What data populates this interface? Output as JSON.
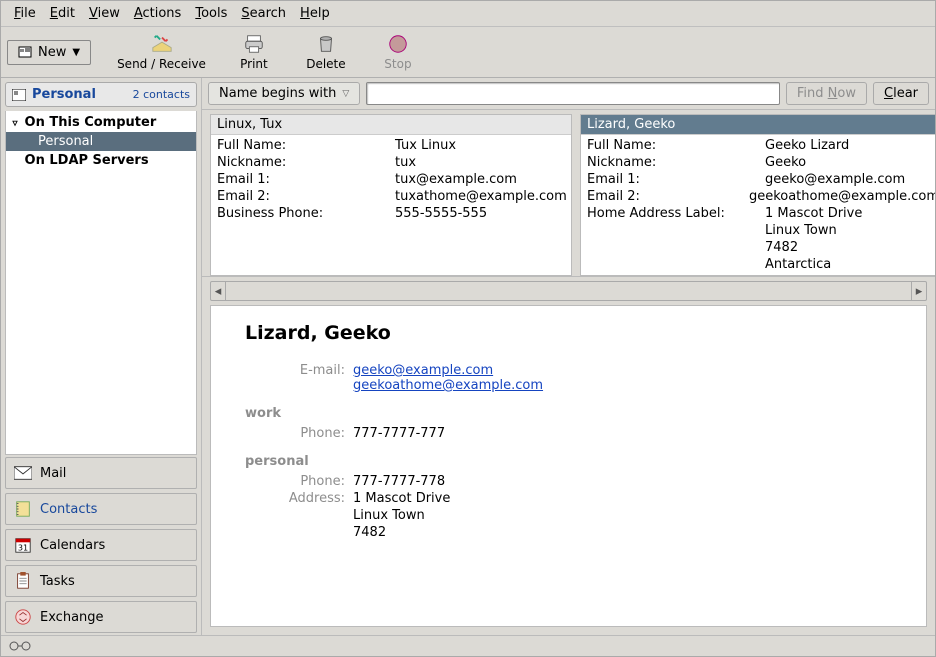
{
  "menu": {
    "file": "File",
    "edit": "Edit",
    "view": "View",
    "actions": "Actions",
    "tools": "Tools",
    "search": "Search",
    "help": "Help"
  },
  "toolbar": {
    "new": "New",
    "send": "Send / Receive",
    "print": "Print",
    "delete": "Delete",
    "stop": "Stop"
  },
  "sidebar": {
    "header_title": "Personal",
    "contact_count": "2 contacts",
    "group_local": "On This Computer",
    "group_local_child": "Personal",
    "group_ldap": "On LDAP Servers",
    "nav": {
      "mail": "Mail",
      "contacts": "Contacts",
      "calendars": "Calendars",
      "tasks": "Tasks",
      "exchange": "Exchange"
    }
  },
  "search": {
    "type_label": "Name begins with",
    "find_label": "Find Now",
    "clear_label": "Clear",
    "value": ""
  },
  "cards": [
    {
      "title": "Linux, Tux",
      "selected": false,
      "rows": [
        {
          "k": "Full Name:",
          "v": "Tux Linux"
        },
        {
          "k": "Nickname:",
          "v": "tux"
        },
        {
          "k": "Email 1:",
          "v": "tux@example.com"
        },
        {
          "k": "Email 2:",
          "v": "tuxathome@example.com"
        },
        {
          "k": "Business Phone:",
          "v": "555-5555-555"
        }
      ]
    },
    {
      "title": "Lizard, Geeko",
      "selected": true,
      "rows": [
        {
          "k": "Full Name:",
          "v": "Geeko Lizard"
        },
        {
          "k": "Nickname:",
          "v": "Geeko"
        },
        {
          "k": "Email 1:",
          "v": "geeko@example.com"
        },
        {
          "k": "Email 2:",
          "v": "geekoathome@example.com"
        },
        {
          "k": "Home Address Label:",
          "v": "1 Mascot Drive\nLinux Town\n7482\nAntarctica"
        }
      ]
    }
  ],
  "detail": {
    "name": "Lizard, Geeko",
    "email_label": "E-mail:",
    "emails": [
      "geeko@example.com",
      "geekoathome@example.com"
    ],
    "sections": [
      {
        "head": "work",
        "rows": [
          {
            "k": "Phone:",
            "v": "777-7777-777"
          }
        ]
      },
      {
        "head": "personal",
        "rows": [
          {
            "k": "Phone:",
            "v": "777-7777-778"
          },
          {
            "k": "Address:",
            "v": "1 Mascot Drive\nLinux Town\n7482"
          }
        ]
      }
    ]
  }
}
